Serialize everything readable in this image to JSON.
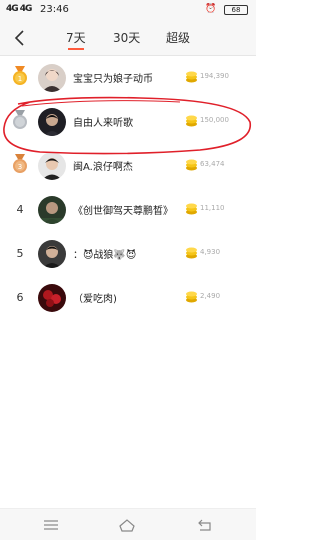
{
  "status_bar": {
    "signal": "4G 4G",
    "time": "23:46",
    "battery": "68"
  },
  "header": {
    "tabs": [
      {
        "label": "7天",
        "active": true
      },
      {
        "label": "30天",
        "active": false
      },
      {
        "label": "超级",
        "active": false
      }
    ]
  },
  "ranking": [
    {
      "rank": "1",
      "name": "宝宝只为娘子动币",
      "coins": "194,390",
      "medal": "gold"
    },
    {
      "rank": "2",
      "name": "自由人来听歌",
      "coins": "150,000",
      "medal": "silver"
    },
    {
      "rank": "3",
      "name": "闽A.浪仔啊杰",
      "coins": "63,474",
      "medal": "bronze"
    },
    {
      "rank": "4",
      "name": "《创世御驾天尊鹏晳》",
      "coins": "11,110",
      "medal": ""
    },
    {
      "rank": "5",
      "name": "：😈战狼🐺😈",
      "coins": "4,930",
      "medal": ""
    },
    {
      "rank": "6",
      "name": "（爱吃肉)",
      "coins": "2,490",
      "medal": ""
    }
  ],
  "colors": {
    "accent": "#ff5a3c",
    "highlight_annotation": "#e0202a",
    "coin": "#f5c518"
  }
}
